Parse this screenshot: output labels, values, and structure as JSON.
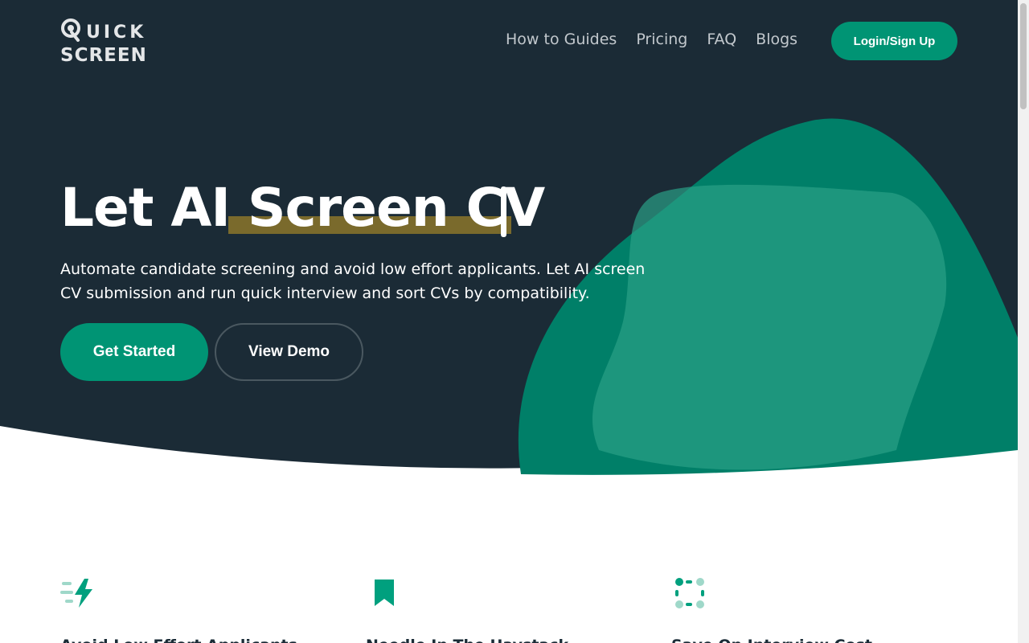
{
  "logo": {
    "line1": "UICK",
    "line2": "SCREEN"
  },
  "nav": {
    "items": [
      "How to Guides",
      "Pricing",
      "FAQ",
      "Blogs"
    ],
    "login_label": "Login/Sign Up"
  },
  "hero": {
    "headline_plain": "Let AI ",
    "headline_highlight": "Screen CV",
    "subtitle": "Automate candidate screening and avoid low effort applicants. Let AI screen CV submission and run quick interview and sort CVs by compatibility.",
    "primary_label": "Get Started",
    "secondary_label": "View Demo"
  },
  "features": [
    {
      "icon": "lightning-icon",
      "title": "Avoid Low Effort Applicants"
    },
    {
      "icon": "bookmark-icon",
      "title": "Needle In The Haystack"
    },
    {
      "icon": "focus-frame-icon",
      "title": "Save On Interview Cost"
    }
  ],
  "colors": {
    "hero_bg": "#1b2b36",
    "accent": "#009474",
    "highlight": "#7a6a2c"
  }
}
